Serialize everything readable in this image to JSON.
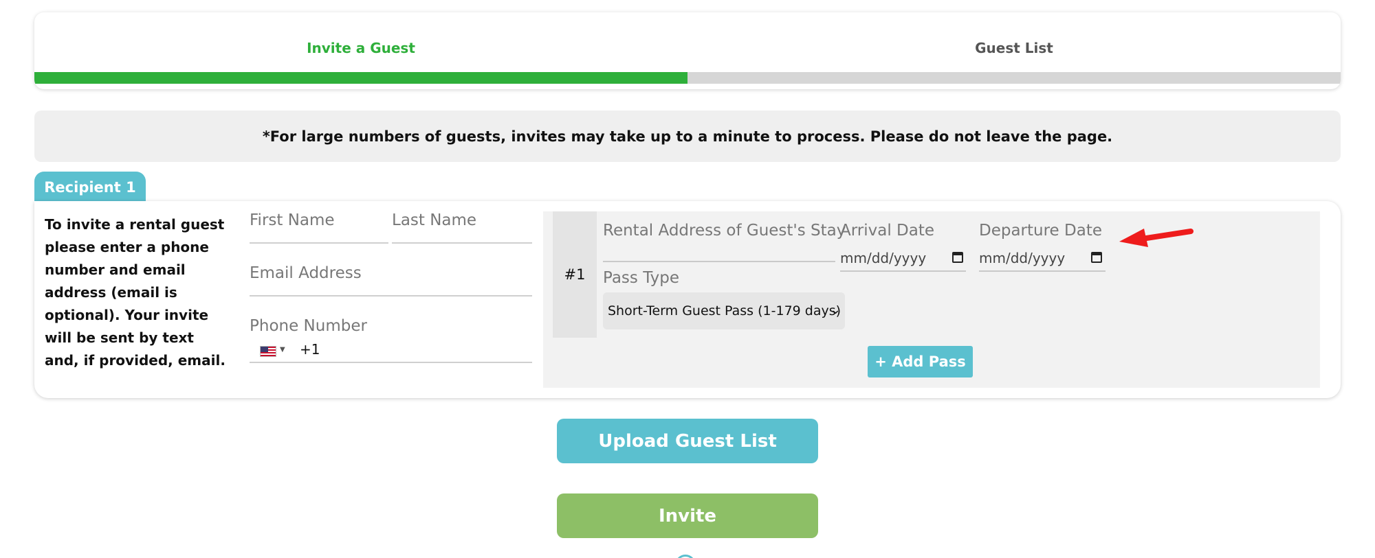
{
  "steps": {
    "active": "Invite a Guest",
    "inactive": "Guest List",
    "progress_fraction": 0.5
  },
  "notice": "*For large numbers of guests, invites may take up to a minute to process. Please do not leave the page.",
  "recipient": {
    "tab_label": "Recipient 1",
    "instructions": "To invite a rental guest please enter a phone number and email address (email is optional). Your invite will be sent by text and, if provided, email.",
    "first_name_placeholder": "First Name",
    "last_name_placeholder": "Last Name",
    "email_placeholder": "Email Address",
    "phone_placeholder": "Phone Number",
    "dial_code": "+1",
    "country_flag_icon": "us-flag-icon"
  },
  "pass": {
    "number": "#1",
    "address_label": "Rental Address of Guest's Stay",
    "arrival_label": "Arrival Date",
    "departure_label": "Departure Date",
    "arrival_value": "mm/dd/yyyy",
    "departure_value": "mm/dd/yyyy",
    "pass_type_label": "Pass Type",
    "pass_type_selected": "Short-Term Guest Pass (1-179 days)",
    "add_pass_label": "+ Add Pass"
  },
  "buttons": {
    "upload": "Upload Guest List",
    "invite": "Invite"
  },
  "colors": {
    "accent_green": "#2eaf3a",
    "teal": "#5bc0cf",
    "invite_green": "#8dbf66",
    "annotation_red": "#ee1c1c"
  }
}
